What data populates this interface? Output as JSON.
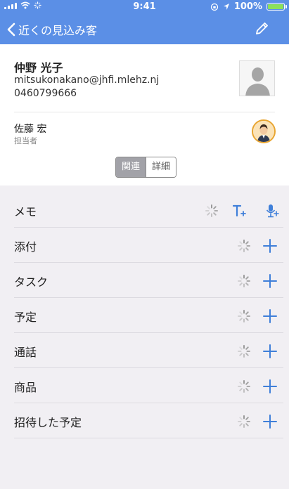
{
  "status_bar": {
    "time": "9:41",
    "battery": "100%"
  },
  "nav": {
    "back_label": "近くの見込み客"
  },
  "contact": {
    "name": "仲野 光子",
    "email": "mitsukonakano@jhfi.mlehz.nj",
    "phone": "0460799666",
    "owner_name": "佐藤 宏",
    "owner_role": "担当者"
  },
  "segment": {
    "related": "関連",
    "details": "詳細"
  },
  "sections": {
    "memo": "メモ",
    "attachments": "添付",
    "tasks": "タスク",
    "events": "予定",
    "calls": "通話",
    "products": "商品",
    "invited_events": "招待した予定"
  },
  "colors": {
    "header_bg": "#5b8fe6",
    "accent": "#3f7fd9",
    "battery_fill": "#8ce05a",
    "avatar_border": "#e8a531"
  },
  "icons": {
    "back": "chevron-left-icon",
    "edit": "pencil-icon",
    "add": "plus-icon",
    "loading": "spinner-icon",
    "text_note": "text-plus-icon",
    "voice_note": "mic-plus-icon"
  }
}
